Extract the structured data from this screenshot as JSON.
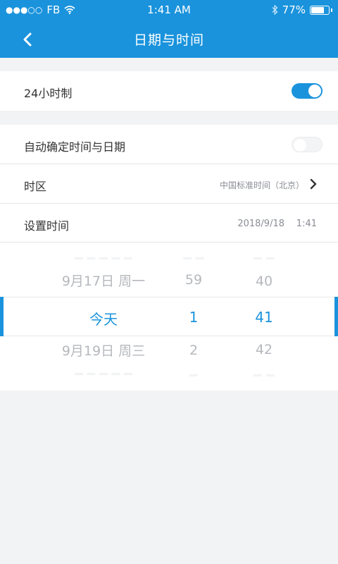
{
  "status_bar": {
    "signal": "●●●○○",
    "carrier": "FB",
    "time": "1:41 AM",
    "battery_percent": "77%",
    "battery_level": 0.77,
    "icons": [
      "wifi-icon",
      "bluetooth-icon",
      "battery-icon"
    ]
  },
  "nav": {
    "title": "日期与时间",
    "back_icon": "chevron-left-icon"
  },
  "settings": {
    "clock_24h": {
      "label": "24小时制",
      "enabled": true
    },
    "auto_datetime": {
      "label": "自动确定时间与日期",
      "enabled": false
    },
    "timezone": {
      "label": "时区",
      "value": "中国标准时间（北京）"
    },
    "set_time": {
      "label": "设置时间",
      "date": "2018/9/18",
      "time": "1:41"
    }
  },
  "picker": {
    "date_column": {
      "above": "9月17日 周一",
      "selected": "今天",
      "below": "9月19日 周三"
    },
    "hour_column": {
      "above": "59",
      "selected": "1",
      "below": "2"
    },
    "minute_column": {
      "above": "40",
      "selected": "41",
      "below": "42"
    }
  },
  "colors": {
    "accent": "#1a93dc",
    "background": "#f2f3f5",
    "text": "#333333",
    "secondary_text": "#8a8d94"
  }
}
